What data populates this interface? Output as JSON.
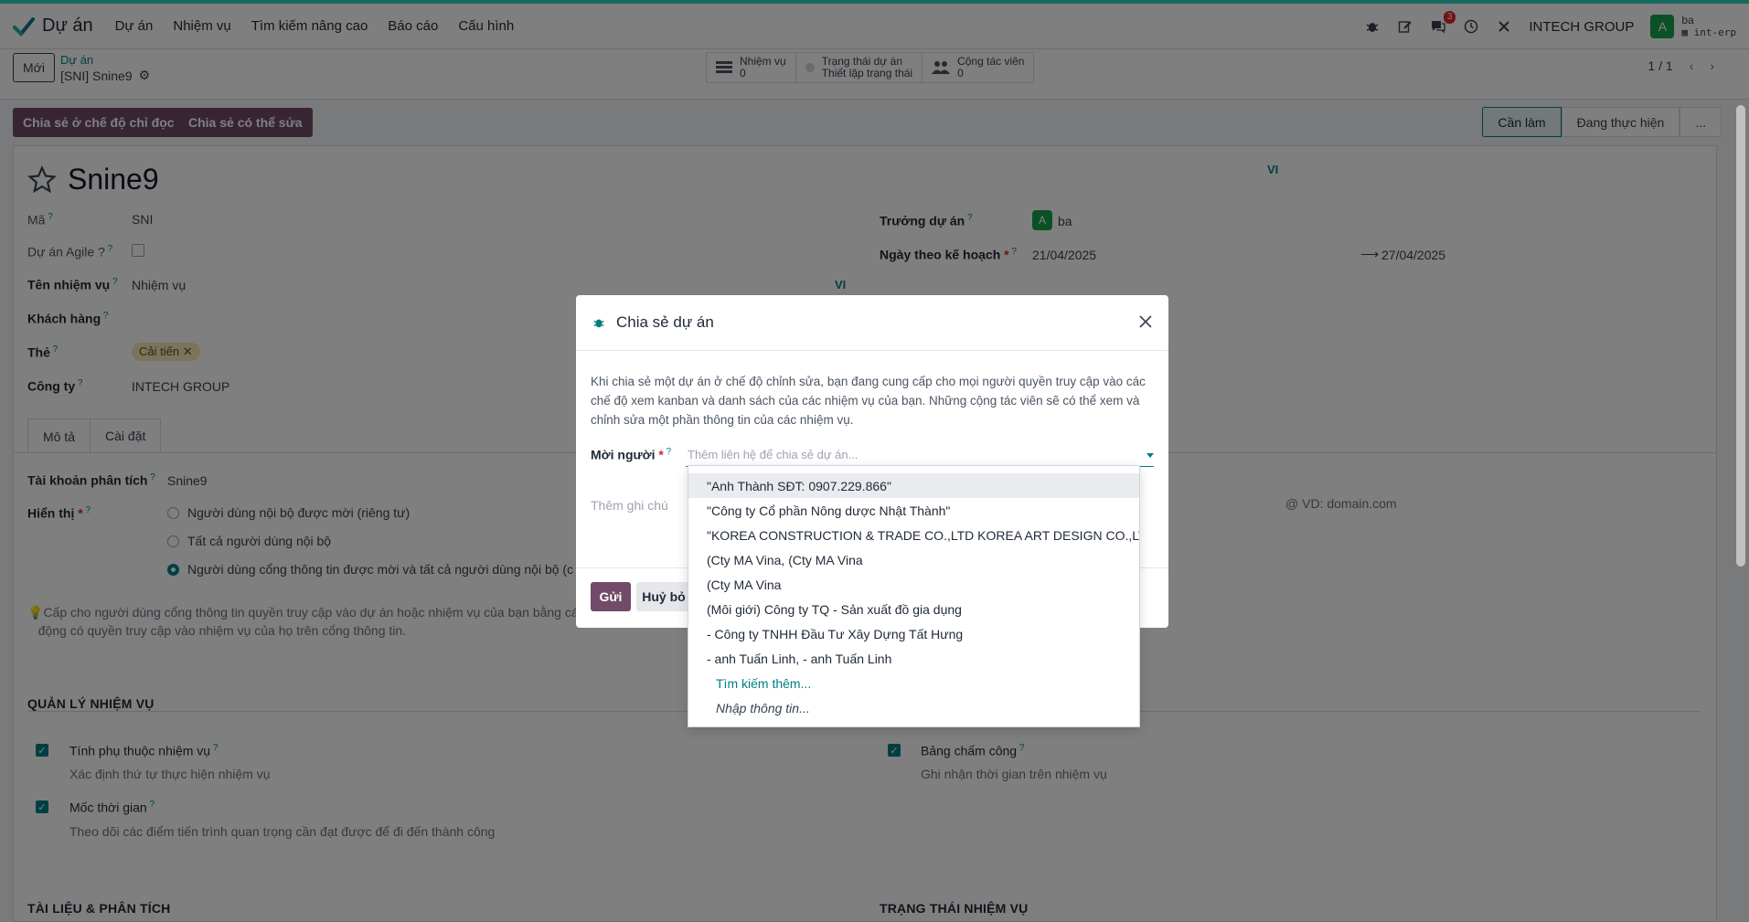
{
  "topbar": {
    "app_name": "Dự án",
    "menu": [
      "Dự án",
      "Nhiệm vụ",
      "Tìm kiếm nâng cao",
      "Báo cáo",
      "Cấu hình"
    ],
    "messages_count": "3",
    "company": "INTECH GROUP",
    "user_initial": "A",
    "user_name": "ba",
    "database": "int-erp"
  },
  "control": {
    "new_label": "Mới",
    "breadcrumb_parent": "Dự án",
    "breadcrumb_current": "[SNI] Snine9",
    "smart_buttons": [
      {
        "label": "Nhiệm vụ",
        "value": "0",
        "icon": "tasks-icon"
      },
      {
        "label": "Trạng thái dự án",
        "value": "Thiết lập trạng thái",
        "icon": "status-dot-icon"
      },
      {
        "label": "Cộng tác viên",
        "value": "0",
        "icon": "users-icon"
      }
    ],
    "pager": "1 / 1"
  },
  "actions": {
    "share_readonly": "Chia sẻ ở chế độ chỉ đọc",
    "share_edit": "Chia sẻ có thể sửa",
    "stages": [
      "Cần làm",
      "Đang thực hiện",
      "..."
    ]
  },
  "form": {
    "name": "Snine9",
    "lang_badge": "VI",
    "code_label": "Mã",
    "code": "SNI",
    "agile_label": "Dự án Agile ?",
    "task_name_label": "Tên nhiệm vụ",
    "task_name": "Nhiệm vụ",
    "customer_label": "Khách hàng",
    "tag_label": "Thẻ",
    "tag": "Cải tiến",
    "company_label": "Công ty",
    "company": "INTECH GROUP",
    "manager_label": "Trưởng dự án",
    "manager_initial": "A",
    "manager": "ba",
    "planned_label": "Ngày theo kế hoạch",
    "date_start": "21/04/2025",
    "date_end": "27/04/2025",
    "tabs": [
      "Mô tả",
      "Cài đặt"
    ],
    "analytic_label": "Tài khoản phân tích",
    "analytic": "Snine9",
    "visibility_label": "Hiển thị",
    "visibility_options": [
      "Người dùng nội bộ được mời (riêng tư)",
      "Tất cả người dùng nội bộ",
      "Người dùng cổng thông tin được mời và tất cả người dùng nội bộ (c"
    ],
    "visibility_hint": "Cấp cho người dùng cổng thông tin quyền truy cập vào dự án hoặc nhiệm vụ của bạn bằng các",
    "visibility_hint2": "động có quyền truy cập vào nhiệm vụ của họ trên cổng thông tin.",
    "email_placeholder": "VD: domain.com",
    "section_tasks": "QUẢN LÝ NHIỆM VỤ",
    "dep_title": "Tính phụ thuộc nhiệm vụ",
    "dep_desc": "Xác định thứ tự thực hiện nhiệm vụ",
    "milestone_title": "Mốc thời gian",
    "milestone_desc": "Theo dõi các điểm tiến trình quan trọng cần đạt được để đi đến thành công",
    "timesheet_title": "Bảng chấm công",
    "timesheet_desc": "Ghi nhận thời gian trên nhiệm vụ",
    "section_docs": "TÀI LIỆU & PHÂN TÍCH",
    "section_status": "TRẠNG THÁI NHIỆM VỤ"
  },
  "modal": {
    "title": "Chia sẻ dự án",
    "description": "Khi chia sẻ một dự án ở chế độ chỉnh sửa, bạn đang cung cấp cho mọi người quyền truy cập vào các chế độ xem kanban và danh sách của các nhiệm vụ của bạn. Những cộng tác viên sẽ có thể xem và chỉnh sửa một phần thông tin của các nhiệm vụ.",
    "invite_label": "Mời người",
    "invite_placeholder": "Thêm liên hệ để chia sẻ dự án...",
    "note_placeholder": "Thêm ghi chú",
    "send": "Gửi",
    "cancel": "Huỷ bỏ"
  },
  "dropdown": {
    "items": [
      "\"Anh Thành SĐT: 0907.229.866\"",
      "\"Công ty Cổ phần Nông dược Nhật Thành\"",
      "\"KOREA CONSTRUCTION & TRADE CO.,LTD KOREA ART DESIGN CO.,LTD \"",
      "(Cty MA Vina, (Cty MA Vina",
      "(Cty MA Vina",
      "(Môi giới) Công ty TQ - Sản xuất đồ gia dụng",
      "- Công ty TNHH Đầu Tư Xây Dựng Tất Hưng",
      "- anh Tuấn Linh, - anh Tuấn Linh"
    ],
    "search_more": "Tìm kiếm thêm...",
    "create": "Nhập thông tin..."
  },
  "colors": {
    "brand": "#714b67",
    "accent": "#017e84",
    "topline": "#2dd4bf"
  }
}
